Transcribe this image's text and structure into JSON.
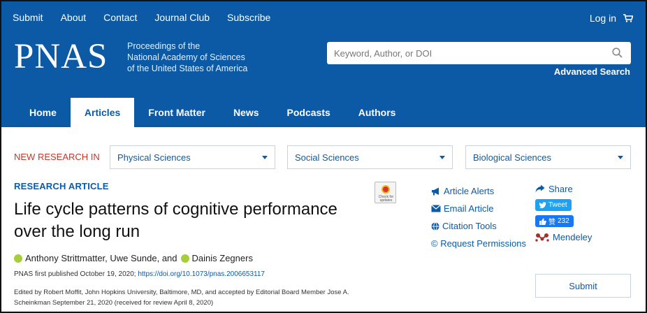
{
  "header": {
    "utility_links": [
      "Submit",
      "About",
      "Contact",
      "Journal Club",
      "Subscribe"
    ],
    "login_label": "Log in",
    "logo": "PNAS",
    "tagline": [
      "Proceedings of the",
      "National Academy of Sciences",
      "of the United States of America"
    ],
    "search_placeholder": "Keyword, Author, or DOI",
    "advanced_search": "Advanced Search",
    "nav_tabs": [
      "Home",
      "Articles",
      "Front Matter",
      "News",
      "Podcasts",
      "Authors"
    ],
    "active_tab": "Articles",
    "brand_color": "#0c5aa6"
  },
  "new_research": {
    "label": "NEW RESEARCH IN",
    "dropdowns": [
      "Physical Sciences",
      "Social Sciences",
      "Biological Sciences"
    ]
  },
  "article": {
    "type": "RESEARCH ARTICLE",
    "crossmark_text": "Check for updates",
    "title_lines": [
      "Life cycle patterns of cognitive performance",
      "over the long run"
    ],
    "authors": {
      "first": "Anthony Strittmatter, Uwe Sunde, and",
      "last": "Dainis Zegners"
    },
    "pub_prefix": "PNAS first published October 19, 2020;",
    "doi": "https://doi.org/10.1073/pnas.2006653117",
    "edited_line1": "Edited by Robert Moffit, John Hopkins University, Baltimore, MD, and accepted by Editorial Board Member Jose A.",
    "edited_line2": "Scheinkman September 21, 2020 (received for review April 8, 2020)"
  },
  "tools": {
    "article_alerts": "Article Alerts",
    "email_article": "Email Article",
    "citation_tools": "Citation Tools",
    "request_permissions": "© Request Permissions",
    "share": "Share",
    "tweet": "Tweet",
    "like_count": "232",
    "like_label": "赞",
    "mendeley": "Mendeley",
    "submit": "Submit"
  }
}
